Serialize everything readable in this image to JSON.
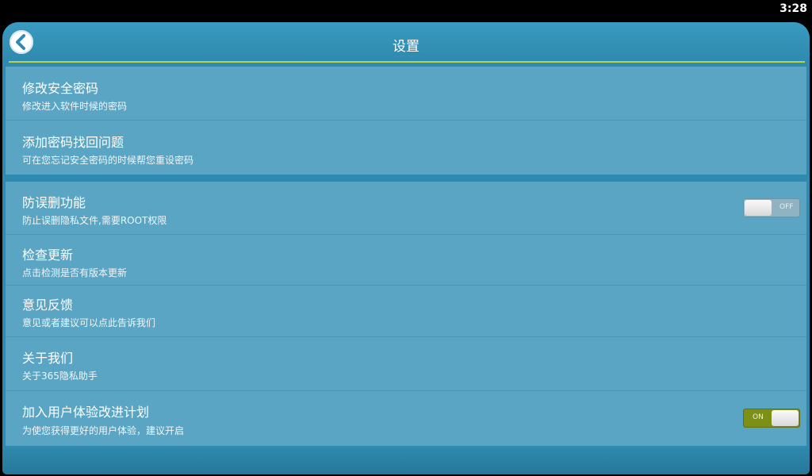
{
  "status_bar": {
    "time": "3:28"
  },
  "header": {
    "title": "设置",
    "back_icon": "chevron-left-icon"
  },
  "groups": [
    {
      "items": [
        {
          "title": "修改安全密码",
          "subtitle": "修改进入软件时候的密码"
        },
        {
          "title": "添加密码找回问题",
          "subtitle": "可在您忘记安全密码的时候帮您重设密码"
        }
      ]
    },
    {
      "items": [
        {
          "title": "防误删功能",
          "subtitle": "防止误删隐私文件,需要ROOT权限",
          "toggle": {
            "label": "OFF",
            "state": "off"
          }
        },
        {
          "title": "检查更新",
          "subtitle": "点击检测是否有版本更新"
        },
        {
          "title": "意见反馈",
          "subtitle": "意见或者建议可以点此告诉我们"
        },
        {
          "title": "关于我们",
          "subtitle": "关于365隐私助手"
        },
        {
          "title": "加入用户体验改进计划",
          "subtitle": "为使您获得更好的用户体验，建议开启",
          "toggle": {
            "label": "ON",
            "state": "on"
          }
        }
      ]
    }
  ],
  "colors": {
    "background": "#2e8aae",
    "list_item": "#5ba5c4",
    "accent_line": "#b8d24a",
    "toggle_on": "#7c8f16"
  }
}
